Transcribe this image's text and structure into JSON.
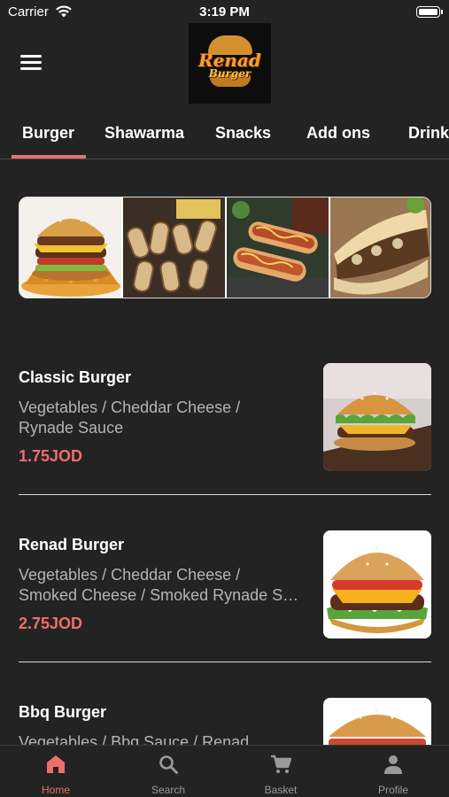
{
  "status_bar": {
    "carrier": "Carrier",
    "time": "3:19 PM"
  },
  "header": {
    "logo_title": "Renad",
    "logo_subtitle": "Burger"
  },
  "tabs": [
    {
      "label": "Burger",
      "active": true
    },
    {
      "label": "Shawarma",
      "active": false
    },
    {
      "label": "Snacks",
      "active": false
    },
    {
      "label": "Add ons",
      "active": false
    },
    {
      "label": "Drinks",
      "active": false
    }
  ],
  "menu_items": [
    {
      "name": "Classic Burger",
      "desc_line1": "Vegetables / Cheddar Cheese /",
      "desc_line2": "Rynade Sauce",
      "price": "1.75JOD"
    },
    {
      "name": "Renad Burger",
      "desc_line1": "Vegetables / Cheddar Cheese /",
      "desc_line2": "Smoked Cheese / Smoked Rynade Sauce",
      "price": "2.75JOD"
    },
    {
      "name": "Bbq Burger",
      "desc_line1": "Vegetables / Bbq Sauce / Renad",
      "desc_line2": "",
      "price": ""
    }
  ],
  "bottom_nav": [
    {
      "label": "Home",
      "icon": "home-icon",
      "active": true
    },
    {
      "label": "Search",
      "icon": "search-icon",
      "active": false
    },
    {
      "label": "Basket",
      "icon": "cart-icon",
      "active": false
    },
    {
      "label": "Profile",
      "icon": "person-icon",
      "active": false
    }
  ],
  "colors": {
    "background": "#232323",
    "accent": "#ee6e6c",
    "text_muted": "#b4b4b4",
    "nav_inactive": "#9a9a9a"
  }
}
